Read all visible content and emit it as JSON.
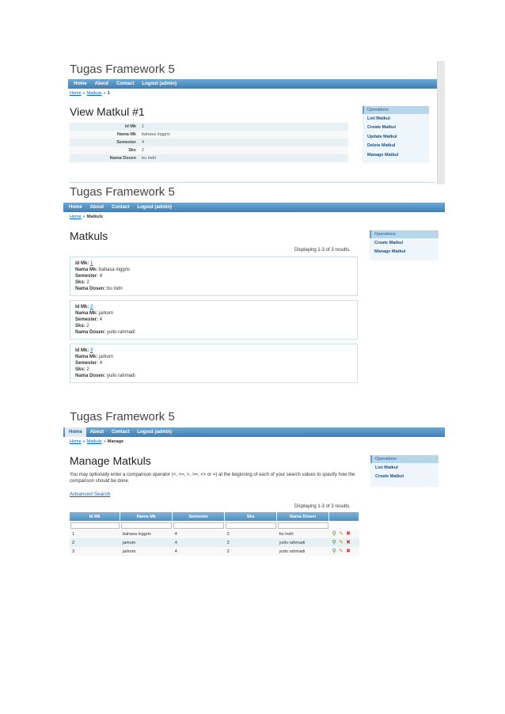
{
  "shots": {
    "view": {
      "app_title": "Tugas Framework 5",
      "menu": [
        "Home",
        "About",
        "Contact",
        "Logout (admin)"
      ],
      "breadcrumb": {
        "home": "Home",
        "matkuls": "Matkuls",
        "sep1": "»",
        "sep2": "»",
        "current": "1"
      },
      "title": "View Matkul #1",
      "ops": {
        "heading": "Operations",
        "items": [
          "List Matkul",
          "Create Matkul",
          "Update Matkul",
          "Delete Matkul",
          "Manage Matkul"
        ]
      },
      "rows": [
        {
          "label": "Id Mk",
          "value": "1"
        },
        {
          "label": "Nama Mk",
          "value": "bahasa inggris"
        },
        {
          "label": "Semester",
          "value": "4"
        },
        {
          "label": "Sks",
          "value": "2"
        },
        {
          "label": "Nama Dosen",
          "value": "bu indri"
        }
      ]
    },
    "list": {
      "app_title": "Tugas Framework 5",
      "menu": [
        "Home",
        "About",
        "Contact",
        "Logout (admin)"
      ],
      "breadcrumb": {
        "home": "Home",
        "sep1": "»",
        "current": "Matkuls"
      },
      "title": "Matkuls",
      "summary": "Displaying 1-3 of 3 results.",
      "ops": {
        "heading": "Operations",
        "items": [
          "Create Matkul",
          "Manage Matkul"
        ]
      },
      "labels": {
        "id": "Id Mk:",
        "nama": "Nama Mk:",
        "semester": "Semester:",
        "sks": "Sks:",
        "dosen": "Nama Dosen:"
      },
      "cards": [
        {
          "id": "1",
          "nama": "bahasa inggris",
          "semester": "4",
          "sks": "2",
          "dosen": "bu indri"
        },
        {
          "id": "2",
          "nama": "jarkom",
          "semester": "4",
          "sks": "2",
          "dosen": "yulio rahmadi"
        },
        {
          "id": "3",
          "nama": "jarkom",
          "semester": "4",
          "sks": "2",
          "dosen": "yulio rahmadi"
        }
      ]
    },
    "manage": {
      "app_title": "Tugas Framework 5",
      "menu": [
        "Home",
        "About",
        "Contact",
        "Logout (admin)"
      ],
      "breadcrumb": {
        "home": "Home",
        "matkuls": "Matkuls",
        "sep1": "»",
        "sep2": "»",
        "current": "Manage"
      },
      "title": "Manage Matkuls",
      "note": "You may optionally enter a comparison operator (<, <=, >, >=, <> or =) at the beginning of each of your search values to specify how the comparison should be done.",
      "advanced_search": "Advanced Search",
      "summary": "Displaying 1-3 of 3 results.",
      "ops": {
        "heading": "Operations",
        "items": [
          "List Matkul",
          "Create Matkul"
        ]
      },
      "columns": [
        "Id Mk",
        "Nama Mk",
        "Semester",
        "Sks",
        "Nama Dosen"
      ],
      "rows": [
        [
          "1",
          "bahasa inggris",
          "4",
          "2",
          "bu indri"
        ],
        [
          "2",
          "jarkom",
          "4",
          "2",
          "yulio rahmadi"
        ],
        [
          "3",
          "jarkom",
          "4",
          "2",
          "yulio rahmadi"
        ]
      ],
      "action_icons": [
        "view-icon",
        "edit-icon",
        "delete-icon"
      ]
    }
  },
  "colors": {
    "menu_bar": "#4f8fc2",
    "link": "#0066cc",
    "ops_bg": "#eef6fb",
    "row_alt": "#e5f1f4",
    "delete": "#d33"
  }
}
